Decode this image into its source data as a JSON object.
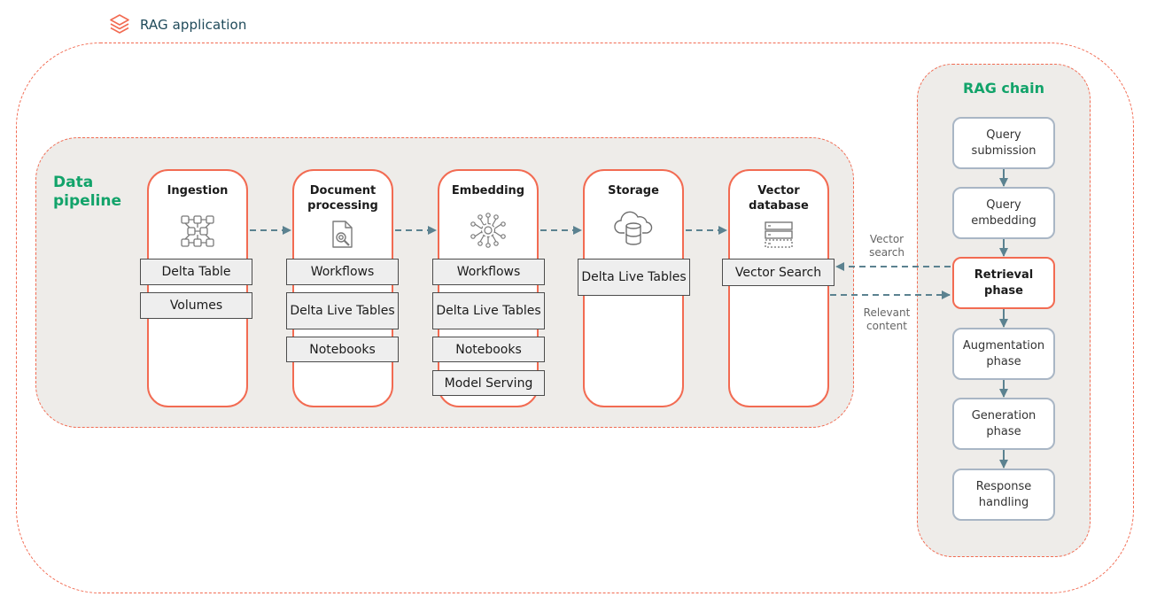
{
  "header": {
    "title": "RAG application",
    "icon": "stacked-layers-icon"
  },
  "colors": {
    "accent_orange": "#f26b52",
    "label_green": "#12a36a",
    "arrow_slate": "#5b8290",
    "panel_bg": "#eeece9",
    "step_border": "#a9b6c5"
  },
  "data_pipeline": {
    "label_line1": "Data",
    "label_line2": "pipeline",
    "stages": [
      {
        "title_line1": "Ingestion",
        "title_line2": "",
        "icon": "network-grid-icon",
        "chips": [
          "Delta Table",
          "Volumes"
        ]
      },
      {
        "title_line1": "Document",
        "title_line2": "processing",
        "icon": "document-search-icon",
        "chips": [
          "Workflows",
          "Delta Live Tables",
          "Notebooks"
        ]
      },
      {
        "title_line1": "Embedding",
        "title_line2": "",
        "icon": "neural-hub-icon",
        "chips": [
          "Workflows",
          "Delta Live Tables",
          "Notebooks",
          "Model Serving"
        ]
      },
      {
        "title_line1": "Storage",
        "title_line2": "",
        "icon": "cloud-database-icon",
        "chips": [
          "Delta Live Tables"
        ]
      },
      {
        "title_line1": "Vector",
        "title_line2": "database",
        "icon": "server-stack-icon",
        "chips": [
          "Vector Search"
        ]
      }
    ]
  },
  "connections": {
    "vector_search_label_line1": "Vector",
    "vector_search_label_line2": "search",
    "relevant_content_label_line1": "Relevant",
    "relevant_content_label_line2": "content"
  },
  "rag_chain": {
    "label": "RAG chain",
    "steps": [
      {
        "line1": "Query",
        "line2": "submission",
        "active": false
      },
      {
        "line1": "Query",
        "line2": "embedding",
        "active": false
      },
      {
        "line1": "Retrieval",
        "line2": "phase",
        "active": true
      },
      {
        "line1": "Augmentation",
        "line2": "phase",
        "active": false
      },
      {
        "line1": "Generation",
        "line2": "phase",
        "active": false
      },
      {
        "line1": "Response",
        "line2": "handling",
        "active": false
      }
    ]
  }
}
